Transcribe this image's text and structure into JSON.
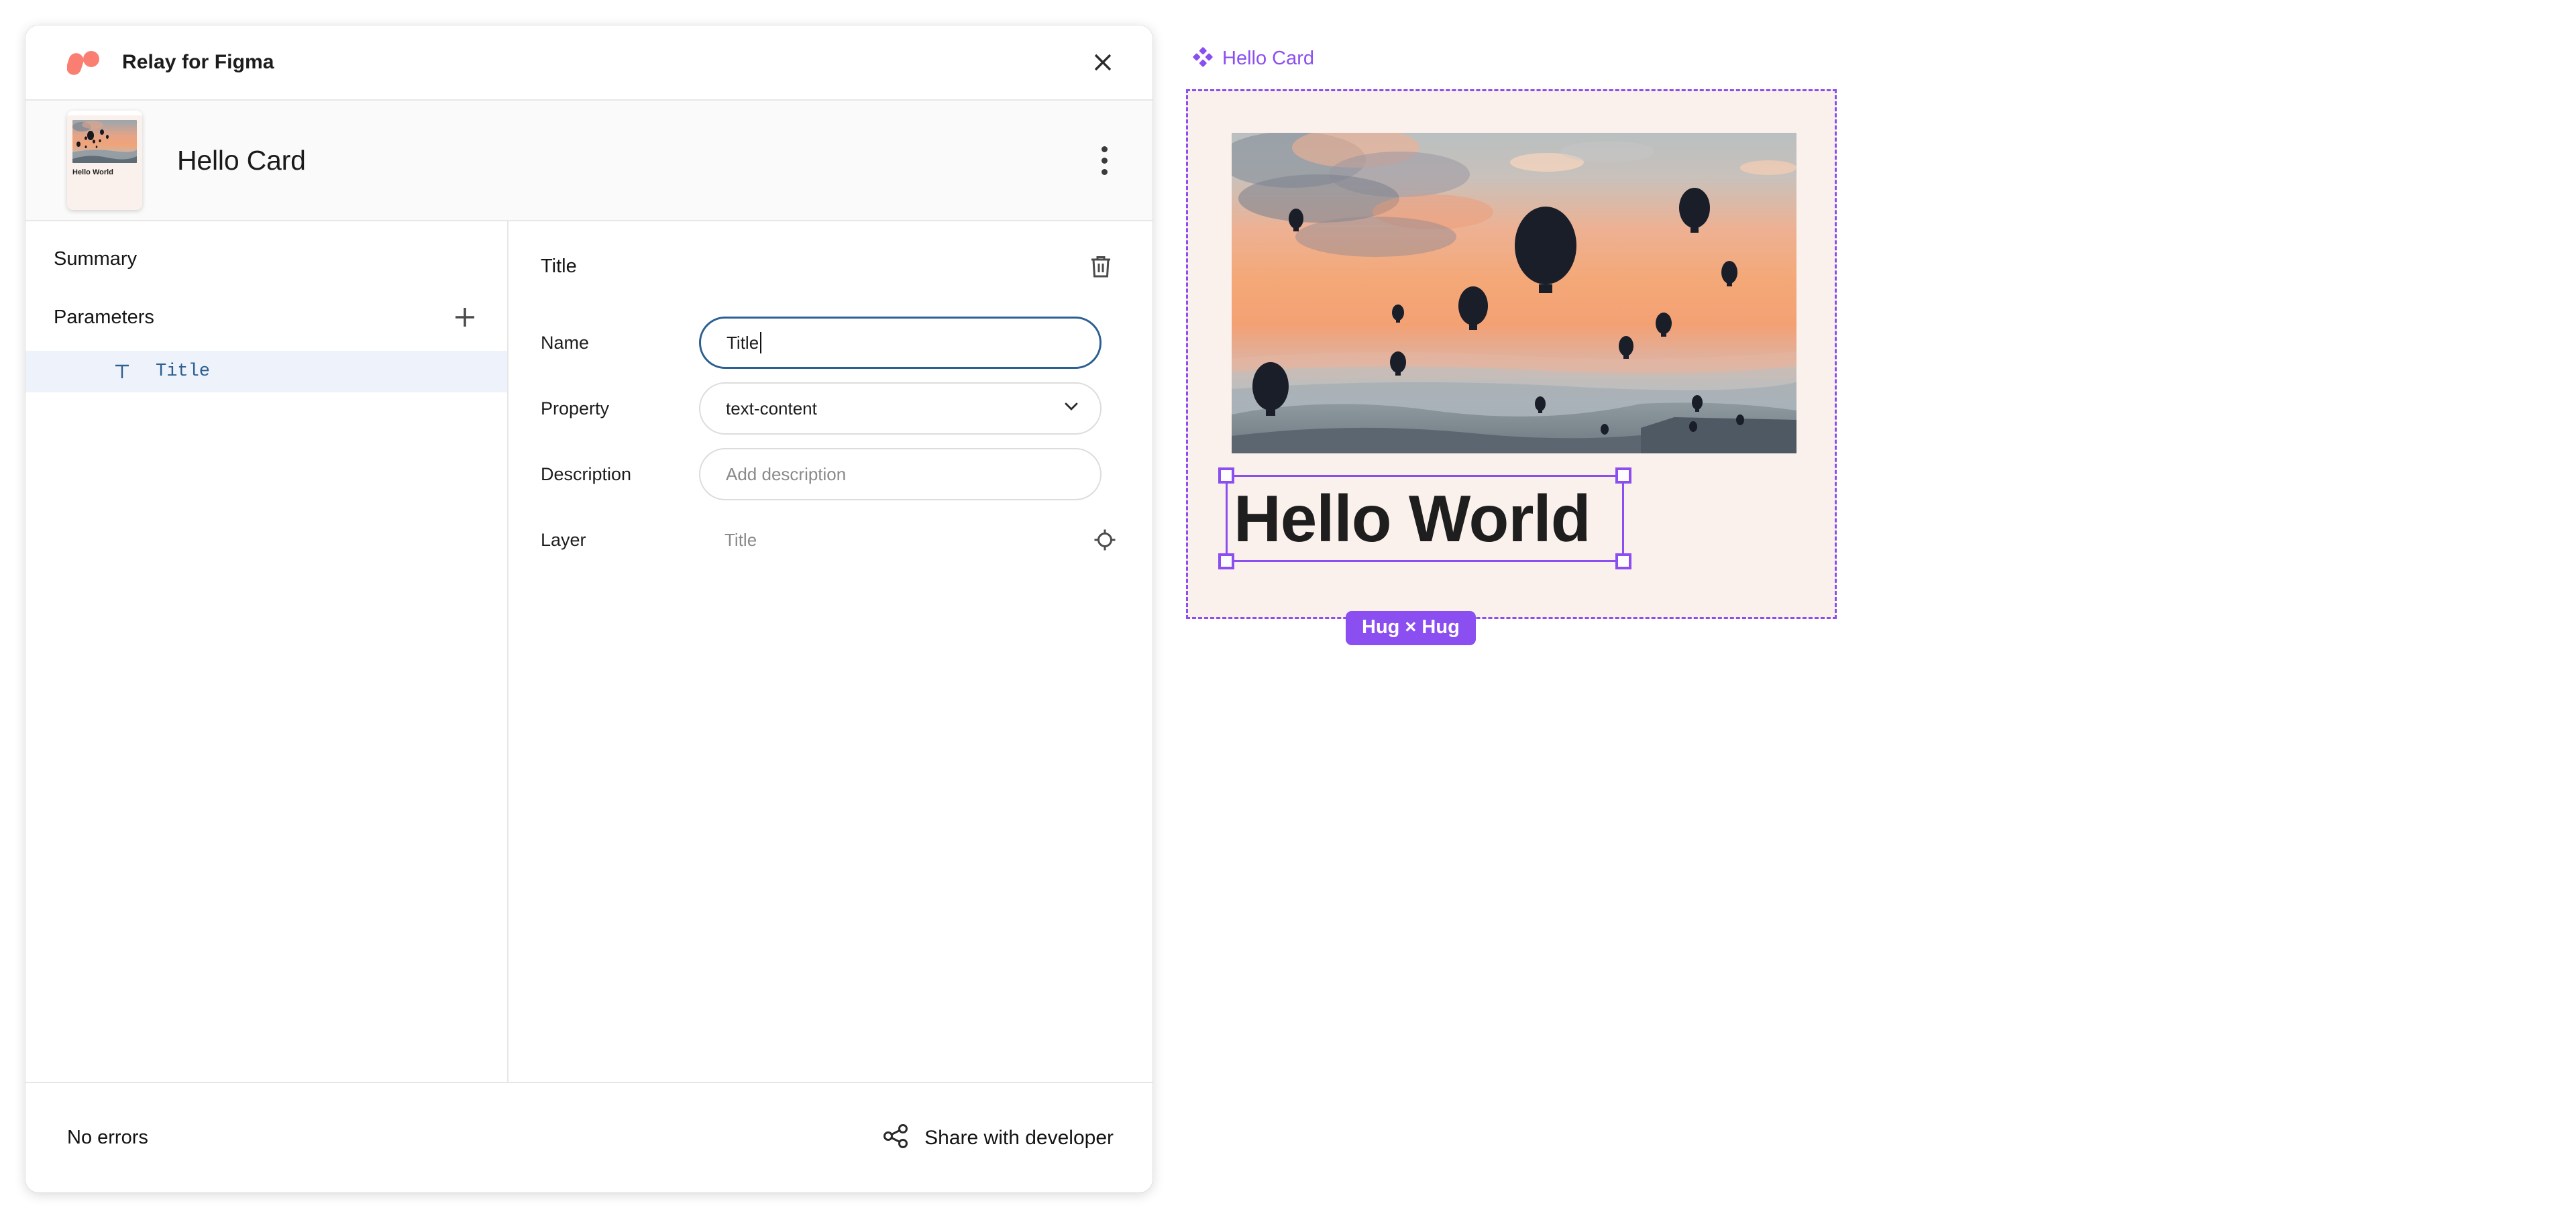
{
  "plugin": {
    "title": "Relay for Figma",
    "logo_icon": "relay-logo-icon",
    "close_icon": "close-icon",
    "accent_color": "#FA7F72"
  },
  "component_header": {
    "name": "Hello Card",
    "thumbnail_label": "Hello World",
    "thumbnail_bg": "#FBF1EC",
    "menu_icon": "kebab-menu-icon"
  },
  "left_panel": {
    "summary_heading": "Summary",
    "parameters_heading": "Parameters",
    "add_icon": "plus-icon",
    "parameters": [
      {
        "label": "Title",
        "type_icon": "text-type-icon",
        "selected": true
      }
    ]
  },
  "detail_panel": {
    "title": "Title",
    "delete_icon": "trash-icon",
    "fields": {
      "name": {
        "label": "Name",
        "value": "Title",
        "focused": true
      },
      "property": {
        "label": "Property",
        "value": "text-content",
        "chevron_icon": "chevron-down-icon",
        "options": [
          "text-content"
        ]
      },
      "description": {
        "label": "Description",
        "value": "",
        "placeholder": "Add description"
      },
      "layer": {
        "label": "Layer",
        "value": "Title",
        "locate_icon": "crosshair-target-icon"
      }
    }
  },
  "footer": {
    "error_status": "No errors",
    "share_label": "Share with developer",
    "share_icon": "share-nodes-icon"
  },
  "canvas": {
    "frame_label": "Hello Card",
    "frame_icon": "figma-component-icon",
    "frame_color": "#8B4EF0",
    "frame_bg": "#FBF1EC",
    "text_layer": "Hello World",
    "size_badge": "Hug × Hug",
    "image_alt": "hot-air-balloons-at-sunset"
  }
}
